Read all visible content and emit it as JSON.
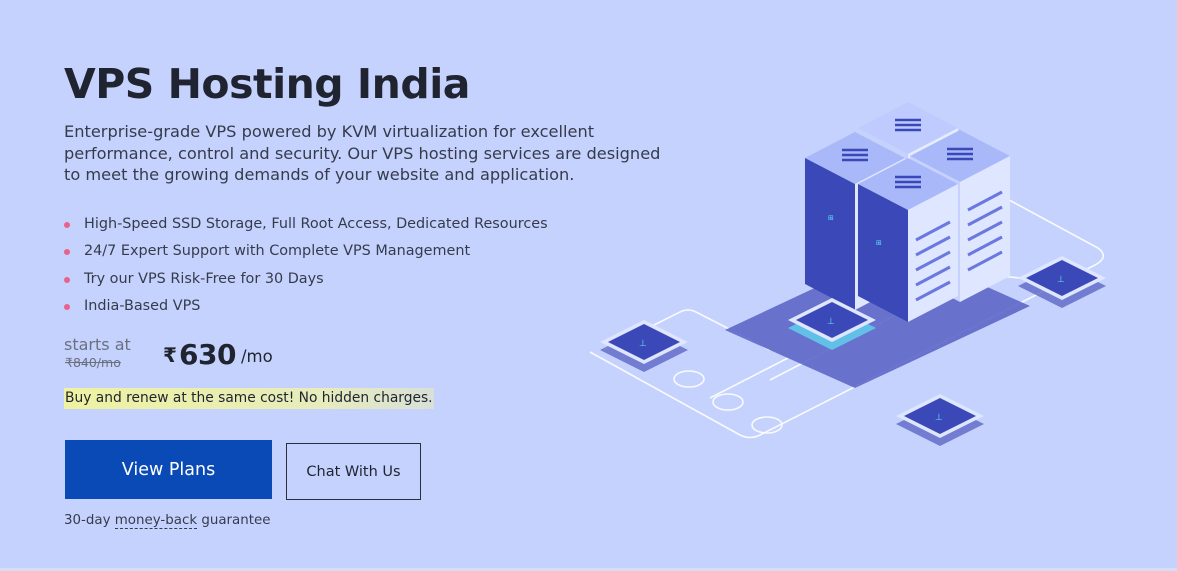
{
  "hero": {
    "title": "VPS Hosting India",
    "description": "Enterprise-grade VPS powered by KVM virtualization for excellent performance, control and security. Our VPS hosting services are designed to meet the growing demands of your website and application.",
    "features": [
      "High-Speed SSD Storage, Full Root Access, Dedicated Resources",
      "24/7 Expert Support with Complete VPS Management",
      "Try our VPS Risk-Free for 30 Days",
      "India-Based VPS"
    ],
    "price": {
      "starts_at_label": "starts at",
      "old_price": "₹840/mo",
      "currency_symbol": "₹",
      "amount": "630",
      "period": "/mo"
    },
    "promo_text": "Buy and renew at the same cost! No hidden charges.",
    "primary_button_label": "View Plans",
    "secondary_button_label": "Chat With Us",
    "guarantee": {
      "prefix": "30-day ",
      "link_text": "money-back",
      "suffix": " guarantee"
    }
  },
  "illustration": {
    "icon": "servers-network-illustration",
    "colors": {
      "server_front": "#3b48b8",
      "server_top": "#a9b8f9",
      "server_side": "#dfe6ff",
      "shadow": "#5d67c6",
      "accent_cyan": "#5ee0f4",
      "lines": "#ffffff"
    }
  },
  "colors": {
    "background": "#c5d2fd",
    "primary_button": "#0a4ab7",
    "bullet": "#e8628a",
    "title": "#1f2430"
  }
}
